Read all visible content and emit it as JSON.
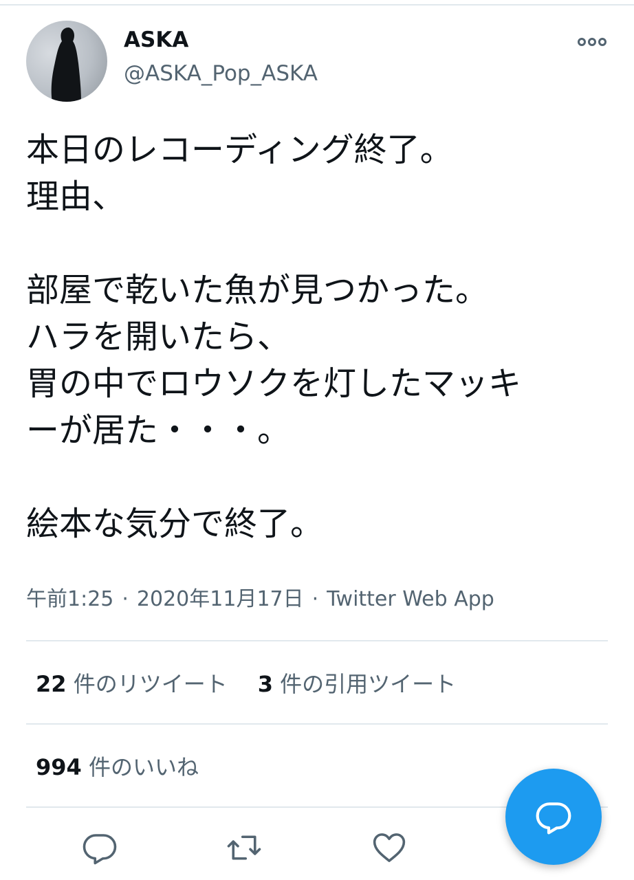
{
  "author": {
    "display_name": "ASKA",
    "handle": "@ASKA_Pop_ASKA",
    "avatar_icon": "avatar-silhouette-icon"
  },
  "tweet": {
    "text": "本日のレコーディング終了。\n理由、\n\n部屋で乾いた魚が見つかった。\nハラを開いたら、\n胃の中でロウソクを灯したマッキ\nーが居た・・・。\n\n絵本な気分で終了。"
  },
  "meta": {
    "time": "午前1:25",
    "separator": "·",
    "date": "2020年11月17日",
    "source": "Twitter Web App"
  },
  "stats": {
    "retweets_count": "22",
    "retweets_label": "件のリツイート",
    "quotes_count": "3",
    "quotes_label": "件の引用ツイート",
    "likes_count": "994",
    "likes_label": "件のいいね"
  },
  "actions": {
    "reply_icon": "reply-icon",
    "retweet_icon": "retweet-icon",
    "like_icon": "heart-icon",
    "more_icon": "more-dots-icon",
    "compose_icon": "compose-message-icon"
  },
  "colors": {
    "accent": "#1d9bf0",
    "text_primary": "#0f1419",
    "text_secondary": "#536471",
    "divider": "#e1e8ed"
  }
}
